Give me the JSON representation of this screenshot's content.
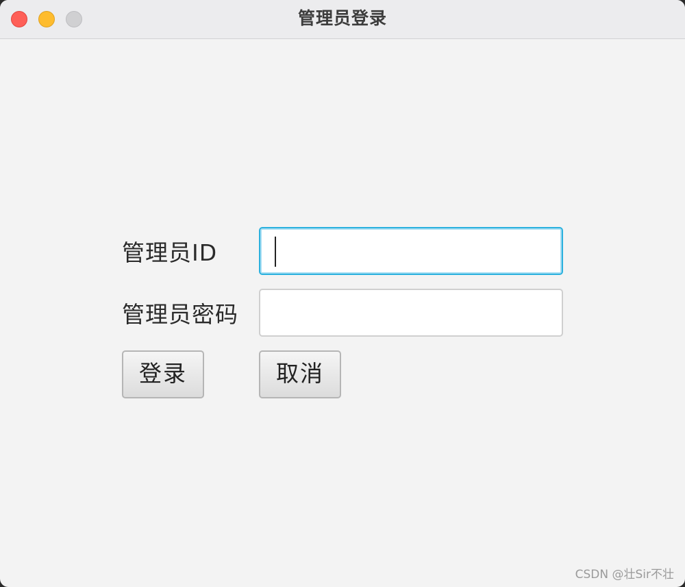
{
  "window": {
    "title": "管理员登录"
  },
  "form": {
    "id_label": "管理员ID",
    "id_value": "",
    "password_label": "管理员密码",
    "password_value": "",
    "login_button": "登录",
    "cancel_button": "取消"
  },
  "watermark": "CSDN @壮Sir不壮",
  "colors": {
    "focus_ring": "#2bb1de",
    "close": "#fe5f57",
    "minimize": "#febc2e",
    "zoom_inactive": "#d0d0d2"
  }
}
